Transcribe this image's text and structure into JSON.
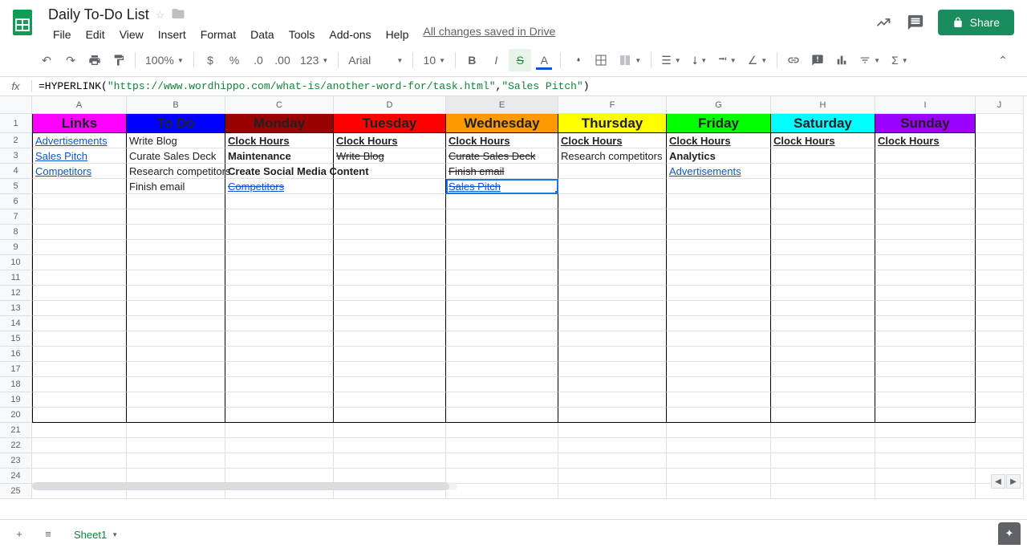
{
  "doc": {
    "title": "Daily To-Do List",
    "drive_status": "All changes saved in Drive"
  },
  "menu": [
    "File",
    "Edit",
    "View",
    "Insert",
    "Format",
    "Data",
    "Tools",
    "Add-ons",
    "Help"
  ],
  "share": "Share",
  "toolbar": {
    "zoom": "100%",
    "font": "Arial",
    "size": "10"
  },
  "formula": {
    "fn": "=HYPERLINK(",
    "arg1": "\"https://www.wordhippo.com/what-is/another-word-for/task.html\"",
    "sep": ",",
    "arg2": "\"Sales Pitch\"",
    "close": ")"
  },
  "columns": [
    "A",
    "B",
    "C",
    "D",
    "E",
    "F",
    "G",
    "H",
    "I",
    "J"
  ],
  "rows": [
    "1",
    "2",
    "3",
    "4",
    "5",
    "6",
    "7",
    "8",
    "9",
    "10",
    "11",
    "12",
    "13",
    "14",
    "15",
    "16",
    "17",
    "18",
    "19",
    "20",
    "21",
    "22",
    "23",
    "24",
    "25"
  ],
  "headers": {
    "A": "Links",
    "B": "To Do",
    "C": "Monday",
    "D": "Tuesday",
    "E": "Wednesday",
    "F": "Thursday",
    "G": "Friday",
    "H": "Saturday",
    "I": "Sunday"
  },
  "header_colors": {
    "A": "#ff00ff",
    "B": "#0000ff",
    "C": "#990000",
    "D": "#ff0000",
    "E": "#ff9900",
    "F": "#ffff00",
    "G": "#00ff00",
    "H": "#00ffff",
    "I": "#9900ff"
  },
  "cells": {
    "A2": "Advertisements",
    "A3": "Sales Pitch",
    "A4": "Competitors",
    "B2": "Write Blog",
    "B3": "Curate Sales Deck",
    "B4": "Research competitors",
    "B5": "Finish email",
    "C2": "Clock Hours",
    "C3": "Maintenance",
    "C4": "Create Social Media Content",
    "C5": "Competitors",
    "D2": "Clock Hours",
    "D3": "Write Blog",
    "E2": "Clock Hours",
    "E3": "Curate Sales Deck",
    "E4": "Finish email",
    "E5": "Sales Pitch",
    "F2": "Clock Hours",
    "F3": "Research competitors",
    "G2": "Clock Hours",
    "G3": "Analytics",
    "G4": "Advertisements",
    "H2": "Clock Hours",
    "I2": "Clock Hours"
  },
  "sheet_tab": "Sheet1"
}
